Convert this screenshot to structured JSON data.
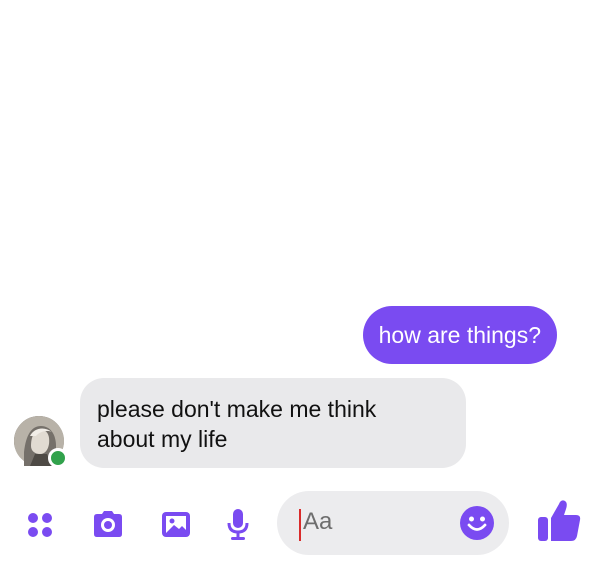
{
  "chat": {
    "outgoing": [
      {
        "text": "how are things?"
      }
    ],
    "incoming": [
      {
        "text_line1": "please don't make me think",
        "text_line2": "about my life"
      }
    ]
  },
  "composer": {
    "placeholder": "Aa",
    "icons": [
      "apps-icon",
      "camera-icon",
      "gallery-icon",
      "microphone-icon",
      "emoji-icon",
      "thumbs-up-icon"
    ]
  },
  "colors": {
    "accent": "#7a4bf1",
    "incoming_bubble": "#e9e9eb",
    "online": "#31a24c"
  }
}
